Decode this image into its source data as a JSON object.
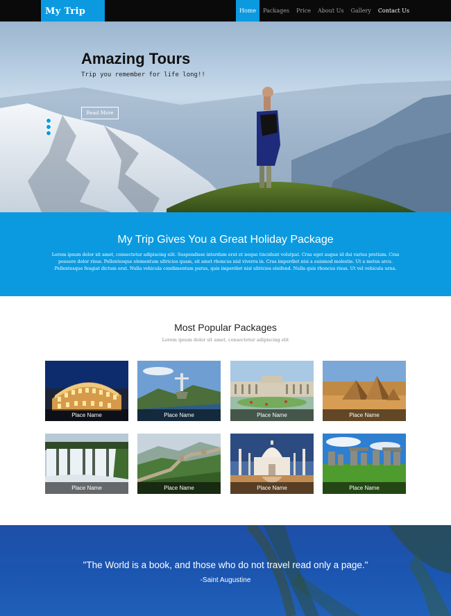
{
  "site": {
    "logo": "My Trip"
  },
  "nav": {
    "items": [
      {
        "label": "Home",
        "active": true
      },
      {
        "label": "Packages"
      },
      {
        "label": "Price"
      },
      {
        "label": "About Us"
      },
      {
        "label": "Gallery"
      },
      {
        "label": "Contact Us"
      }
    ]
  },
  "hero": {
    "title": "Amazing Tours",
    "subtitle": "Trip you remember for life long!!",
    "button": "Read More",
    "slides": 3
  },
  "intro": {
    "title": "My Trip Gives You a Great Holiday Package",
    "text": "Lorem ipsum dolor sit amet, consectetur adipiscing elit. Suspendisse interdum erat et neque tincidunt volutpat. Cras eget augue id dui varius pretium. Cras posuere dolor risus. Pellentesque elementum ultricies quam, sit amet rhoncus nisl viverra in. Cras imperdiet nisi a euismod molestie. Ut a metus arcu. Pellentesque feugiat dictum erat. Nulla vehicula condimentum purus, quis imperdiet nisl ultricies eleifend. Nulla quis rhoncus risus. Ut vel vehicula urna."
  },
  "packages": {
    "title": "Most Popular Packages",
    "subtitle": "Lorem ipsum dolor sit amet, consectetur adipiscing elit",
    "items": [
      {
        "label": "Place Name",
        "scene": "colosseum"
      },
      {
        "label": "Place Name",
        "scene": "rio"
      },
      {
        "label": "Place Name",
        "scene": "palace"
      },
      {
        "label": "Place Name",
        "scene": "pyramids"
      },
      {
        "label": "Place Name",
        "scene": "waterfall"
      },
      {
        "label": "Place Name",
        "scene": "great-wall"
      },
      {
        "label": "Place Name",
        "scene": "taj-mahal"
      },
      {
        "label": "Place Name",
        "scene": "stonehenge"
      }
    ]
  },
  "quote": {
    "text": "\"The World is a book, and those who do not travel read only a page.\"",
    "author": "-Saint Augustine"
  },
  "colors": {
    "accent": "#0b9ae0",
    "topbar": "#0a0a0a",
    "quote_bg": "#1b55b0"
  }
}
